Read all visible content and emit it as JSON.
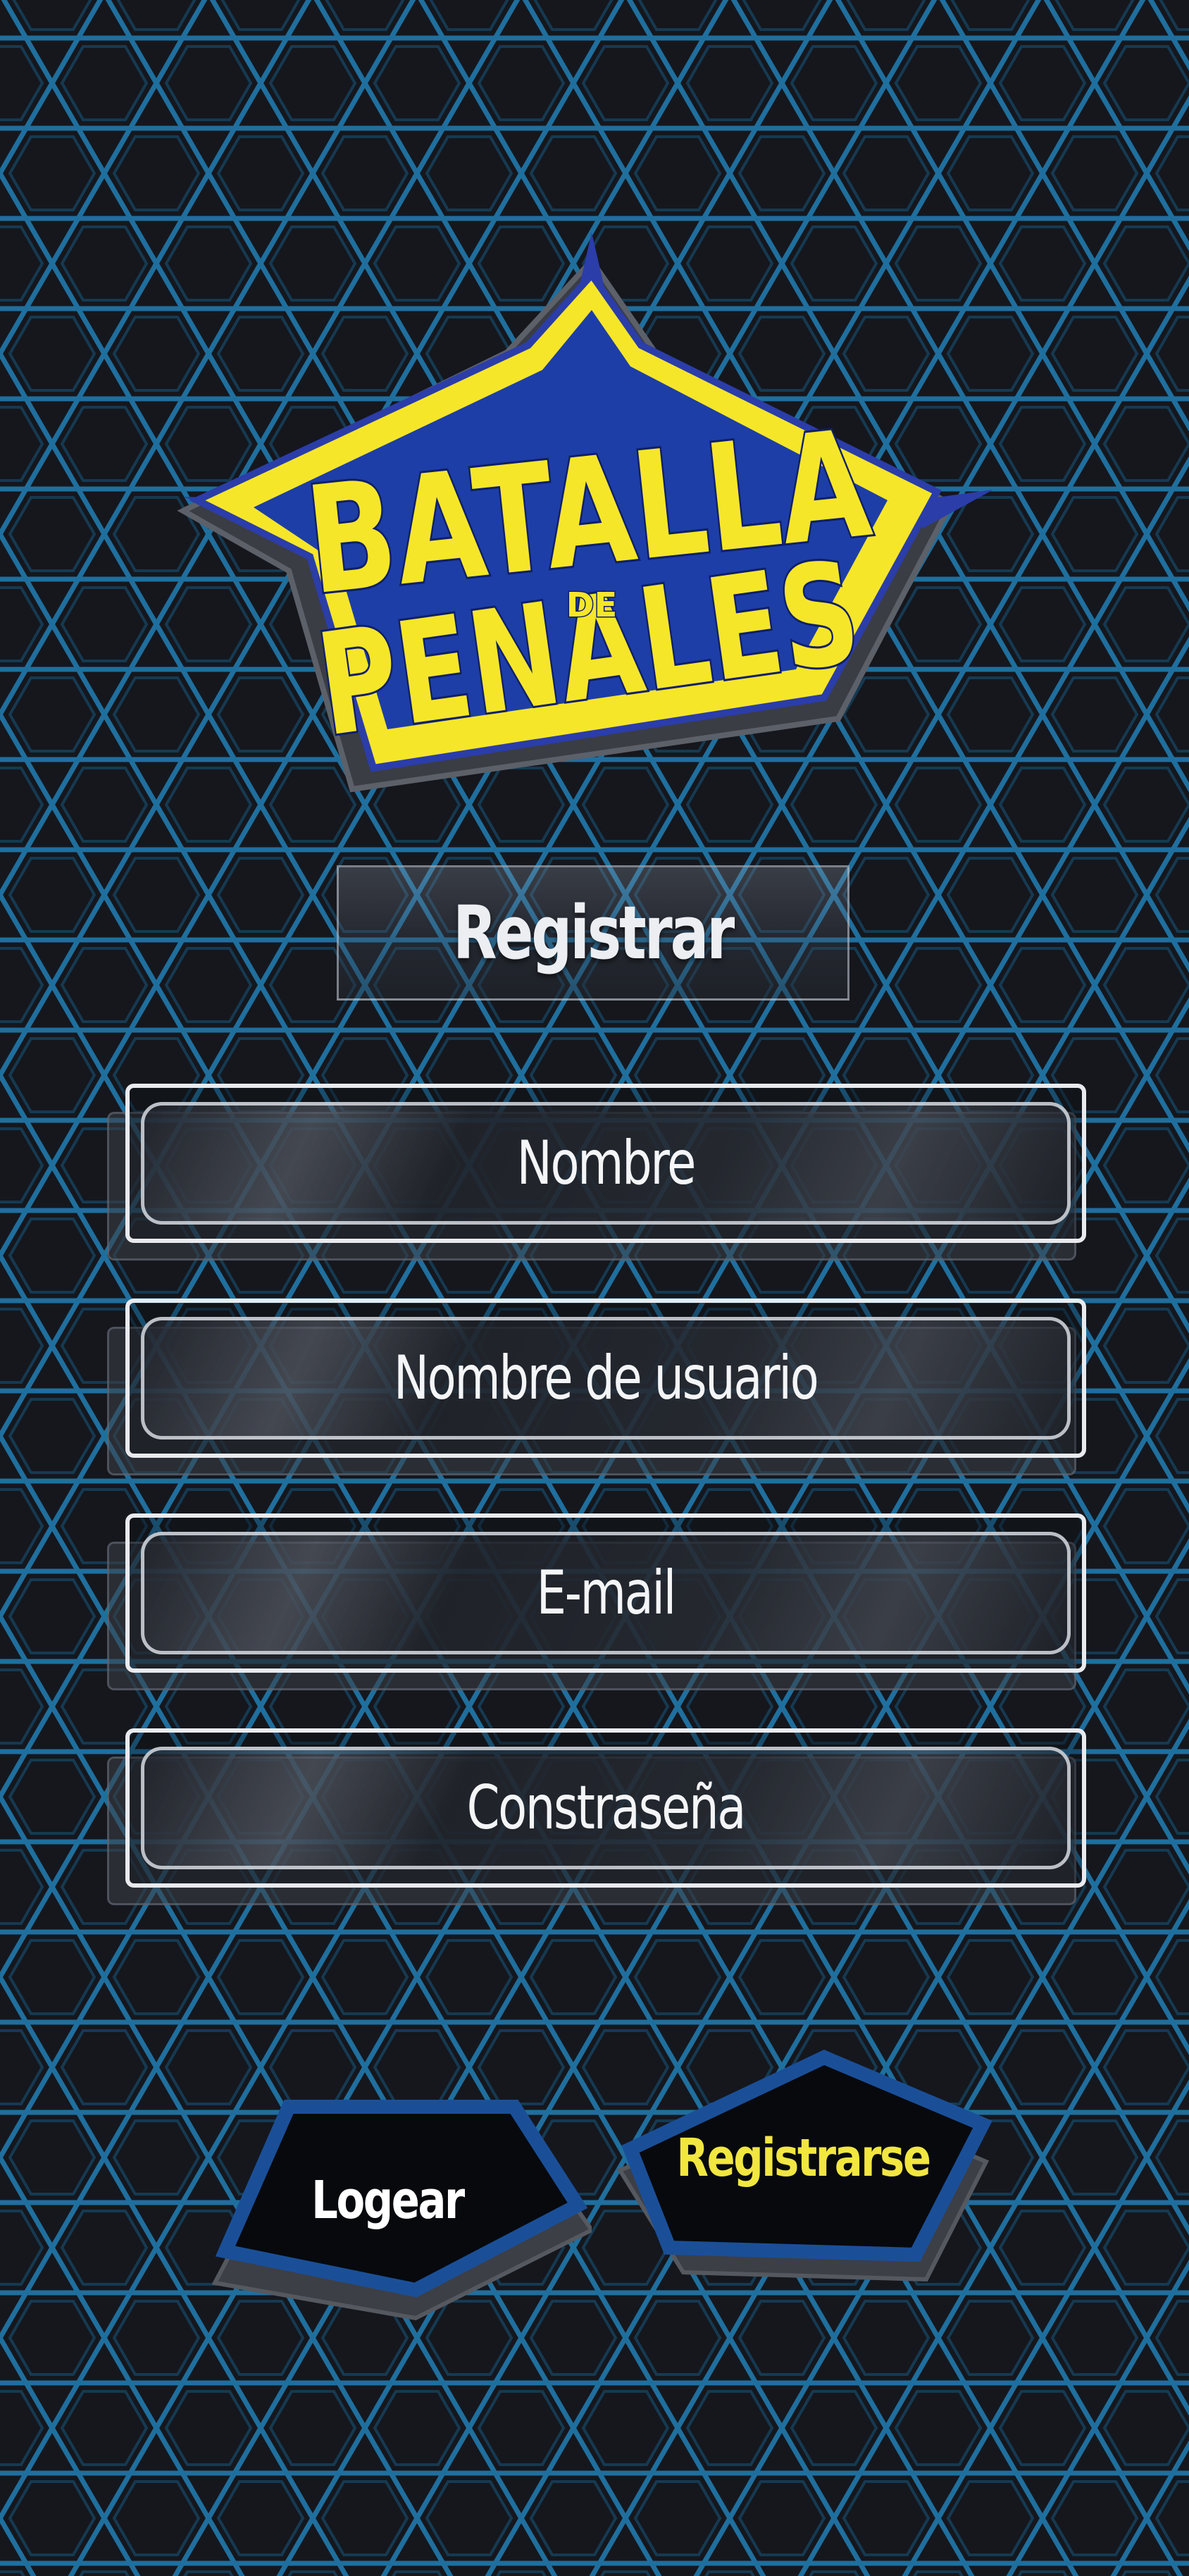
{
  "app": {
    "logo_line1": "BATALLA",
    "logo_de": "DE",
    "logo_line2": "PENALES"
  },
  "form": {
    "title": "Registrar",
    "fields": [
      {
        "label": "Nombre"
      },
      {
        "label": "Nombre de usuario"
      },
      {
        "label": "E-mail"
      },
      {
        "label": "Constraseña"
      }
    ]
  },
  "actions": {
    "login_label": "Logear",
    "register_label": "Registrarse"
  },
  "colors": {
    "background": "#15171d",
    "hex_pattern": "#1f6f9e",
    "logo_yellow": "#f6e62a",
    "logo_blue": "#1d3ea6",
    "button_border": "#1a4f98",
    "register_text": "#f2e640",
    "login_text": "#ffffff"
  }
}
